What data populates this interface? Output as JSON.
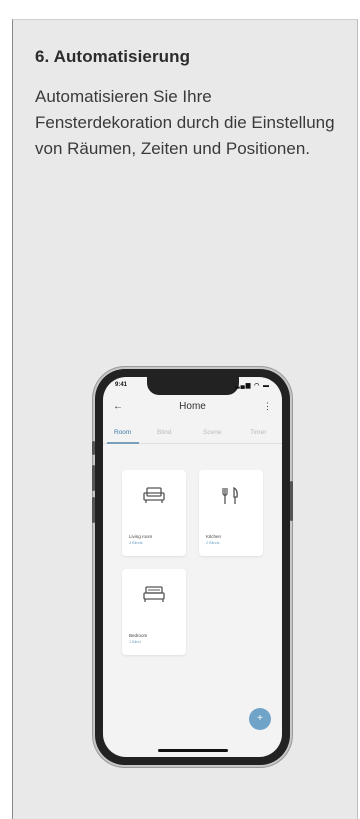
{
  "section": {
    "title": "6. Automatisierung",
    "description": "Automatisieren Sie Ihre Fensterdekoration durch die Einstellung von Räumen, Zeiten und Positionen."
  },
  "phone": {
    "status_time": "9:41",
    "status_icons": "signal-wifi-battery",
    "nav": {
      "back_icon": "back-arrow-icon",
      "title": "Home",
      "more_icon": "more-vert-icon"
    },
    "tabs": [
      {
        "label": "Room",
        "active": true
      },
      {
        "label": "Blind",
        "active": false
      },
      {
        "label": "Scene",
        "active": false
      },
      {
        "label": "Timer",
        "active": false
      }
    ],
    "rooms": [
      {
        "name": "Living room",
        "sub": "3 Blinds",
        "icon": "sofa-icon"
      },
      {
        "name": "Kitchen",
        "sub": "2 Blinds",
        "icon": "cutlery-icon"
      },
      {
        "name": "Bedroom",
        "sub": "1 Blind",
        "icon": "bed-icon"
      }
    ],
    "fab_icon": "plus-icon",
    "accent": "#6fa3c8"
  }
}
